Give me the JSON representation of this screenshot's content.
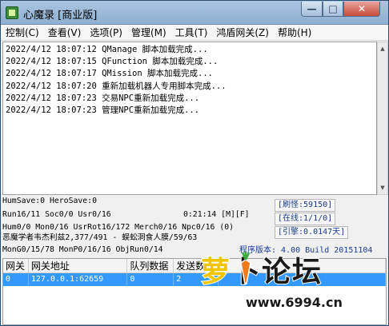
{
  "window": {
    "title": "心魔录 [商业版]",
    "controls": {
      "minimize": "—",
      "maximize": "□",
      "close": "✕"
    }
  },
  "menu": [
    "控制(C)",
    "查看(V)",
    "选项(P)",
    "管理(M)",
    "工具(T)",
    "鸿盾网关(Z)",
    "帮助(H)"
  ],
  "log": [
    "2022/4/12 18:07:12 QManage 脚本加载完成...",
    "2022/4/12 18:07:15 QFunction 脚本加载完成...",
    "2022/4/12 18:07:17 QMission 脚本加载完成...",
    "2022/4/12 18:07:20 重新加载机器人专用脚本完成...",
    "2022/4/12 18:07:23 交易NPC重新加载完成...",
    "2022/4/12 18:07:23 管理NPC重新加载完成..."
  ],
  "status": {
    "humsave": "HumSave:0 HeroSave:0",
    "run": "Run16/11 Soc0/0 Usr0/16",
    "time": "0:21:14 [M][F]",
    "hum": "Hum0/0 Mon0/16 UsrRot16/172 Merch0/16 Npc0/16 (0)",
    "monster": "恶魔学者韦杰利兹2,377/491 - 蜈蚣洞食人膜/59/63",
    "mong": "MonG0/15/78 MonP0/16/16 ObjRun0/14",
    "refresh": "[刷怪:59150]",
    "online": "[在线:1/1/0]",
    "engine": "[引擎:0.0147天]",
    "version": "程序版本: 4.00 Build 20151104"
  },
  "table": {
    "headers": [
      "网关",
      "网关地址",
      "队列数据",
      "发送数",
      ""
    ],
    "rows": [
      [
        "0",
        "127.0.0.1:62659",
        "0",
        "2",
        ""
      ]
    ]
  },
  "watermark": {
    "title_a": "萝",
    "title_b": "卜论坛",
    "url": "www.6994.cn"
  }
}
